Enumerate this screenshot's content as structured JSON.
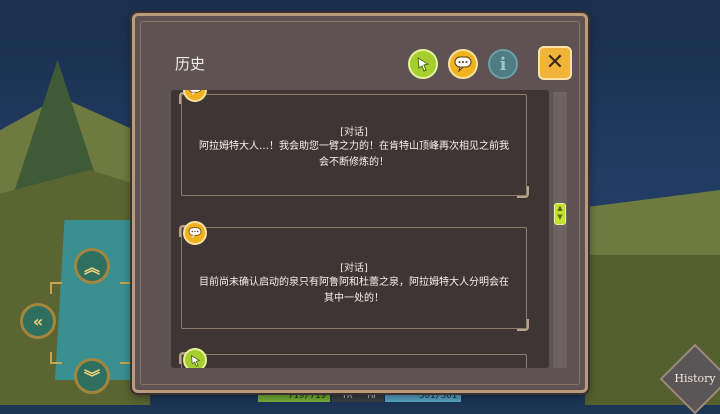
{
  "history_panel": {
    "title": "历史",
    "filters": [
      {
        "name": "choice",
        "icon": "hand-pointer-icon",
        "color": "#a6cf2d"
      },
      {
        "name": "dialog",
        "icon": "speech-bubble-icon",
        "color": "#f0b21f"
      },
      {
        "name": "info",
        "icon": "info-icon",
        "label": "i",
        "color": "#4e7c82"
      }
    ],
    "close_label": "✕",
    "entries": [
      {
        "type": "[对话]",
        "icon": "speech-bubble-icon",
        "text": "阿拉姆特大人…！我会助您一臂之力的！在肯特山顶峰再次相见之前我会不断修炼的！"
      },
      {
        "type": "[对话]",
        "icon": "speech-bubble-icon",
        "text": "目前尚未确认启动的泉只有阿鲁阿和杜蕾之泉，阿拉姆特大人分明会在其中一处的！"
      },
      {
        "type": "",
        "icon": "hand-pointer-icon",
        "text": ""
      }
    ]
  },
  "status_bar": {
    "hp": "719/719",
    "tr_label": "TR",
    "mp_label": "MP",
    "mp": "301/301"
  },
  "history_button_label": "History",
  "colors": {
    "panel_bg": "#5e5252",
    "panel_border": "#b79b7c",
    "accent_yellow": "#f0b21f",
    "accent_green": "#a6cf2d",
    "close_bg": "#f1b43a"
  }
}
